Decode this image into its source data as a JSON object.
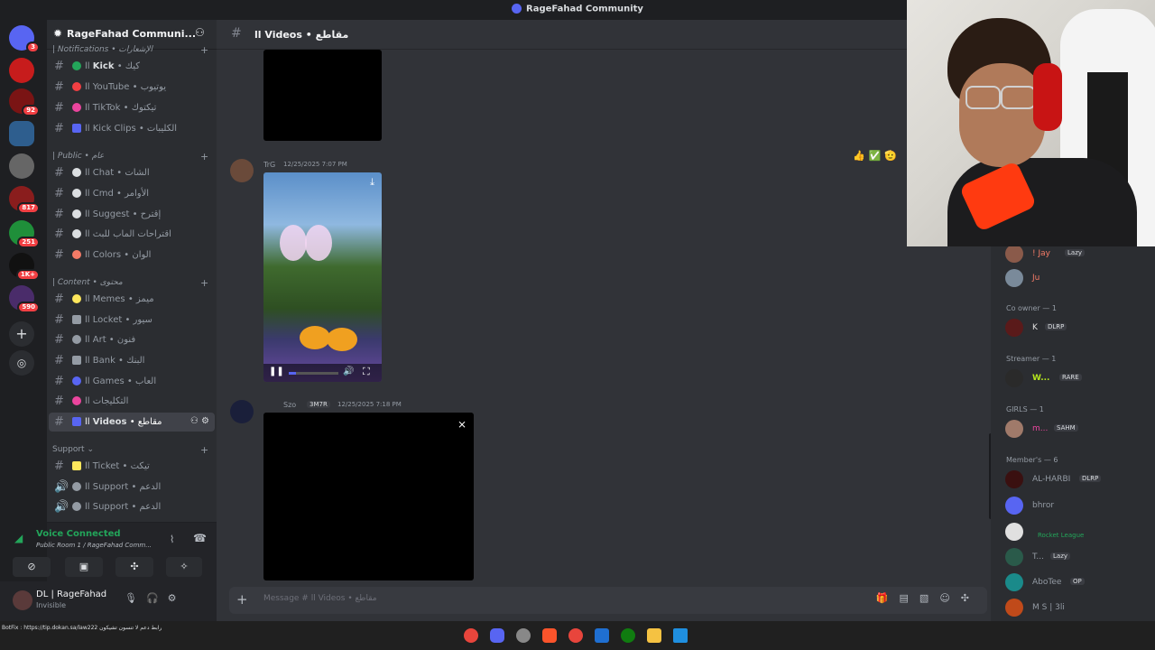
{
  "window": {
    "title": "RageFahad Community"
  },
  "server": {
    "name": "RageFahad Communi..."
  },
  "guild_badges": [
    "3",
    "92",
    "817",
    "251",
    "1K+",
    "590"
  ],
  "categories": {
    "notifications": "| Notifications • الإشعارات",
    "public": "| Public • عام",
    "content": "| Content • محتوى",
    "support": "Support"
  },
  "channels": [
    {
      "name": "Kick",
      "suffix": "كيك",
      "color": "#23a55a"
    },
    {
      "name": "YouTube",
      "suffix": "يوتيوب",
      "color": "#f23f43"
    },
    {
      "name": "TikTok",
      "suffix": "تيكتوك",
      "color": "#eb459e"
    },
    {
      "name": "Kick Clips",
      "suffix": "الكليبات",
      "color": "#5865f2"
    },
    {
      "name": "Chat",
      "suffix": "الشات",
      "color": "#dbdee1"
    },
    {
      "name": "Cmd",
      "suffix": "الأوامر",
      "color": "#dbdee1"
    },
    {
      "name": "Suggest",
      "suffix": "إقترح",
      "color": "#dbdee1"
    },
    {
      "name": "",
      "suffix": "اقتراحات الماب للبث",
      "color": "#dbdee1"
    },
    {
      "name": "Colors",
      "suffix": "الوان",
      "color": "#f47b67"
    },
    {
      "name": "Memes",
      "suffix": "ميمز",
      "color": "#fee75c"
    },
    {
      "name": "Locket",
      "suffix": "سيور",
      "color": "#949ba4"
    },
    {
      "name": "Art",
      "suffix": "فنون",
      "color": "#949ba4"
    },
    {
      "name": "Bank",
      "suffix": "البنك",
      "color": "#949ba4"
    },
    {
      "name": "Games",
      "suffix": "العاب",
      "color": "#5865f2"
    },
    {
      "name": "",
      "suffix": "التكليجات",
      "color": "#eb459e"
    },
    {
      "name": "Videos",
      "suffix": "مقاطع",
      "color": "#5865f2"
    },
    {
      "name": "Ticket",
      "suffix": "تيكت",
      "color": "#fee75c"
    },
    {
      "name": "Support",
      "suffix": "الدعم",
      "color": "#949ba4"
    },
    {
      "name": "Support",
      "suffix": "الدعم",
      "color": "#949ba4"
    }
  ],
  "voice": {
    "status": "Voice Connected",
    "room": "Public Room 1 / RageFahad Comm..."
  },
  "user": {
    "name": "DL | RageFahad",
    "status": "Invisible"
  },
  "chat": {
    "channel": "ll Videos • مقاطع",
    "messages": [
      {
        "author": "TrG",
        "time": "12/25/2025 7:07 PM"
      },
      {
        "author": "Szo",
        "tag": "3M7R",
        "time": "12/25/2025 7:18 PM"
      }
    ],
    "composer_placeholder": "Message # ll Videos • مقاطع"
  },
  "members": {
    "top": [
      {
        "name": "! Jay",
        "tag": "Lazy",
        "color": "#f47b67"
      },
      {
        "name": "Ju",
        "color": "#f47b67"
      }
    ],
    "groups": [
      {
        "title": "Co owner — 1",
        "members": [
          {
            "name": "K",
            "tag": "DLRP",
            "color": "#e0e0e0"
          }
        ]
      },
      {
        "title": "Streamer — 1",
        "members": [
          {
            "name": "W...",
            "tag": "RARE",
            "color": "#b5e61d"
          }
        ]
      },
      {
        "title": "GIRLS — 1",
        "members": [
          {
            "name": "m...",
            "tag": "SAHM",
            "color": "#eb459e"
          }
        ]
      },
      {
        "title": "Member's — 6",
        "members": [
          {
            "name": "AL-HARBI",
            "tag": "DLRP",
            "color": "#949ba4"
          },
          {
            "name": "bhror",
            "color": "#949ba4"
          },
          {
            "name": "Rocket League",
            "color": "#949ba4"
          },
          {
            "name": "T...",
            "tag": "Lazy",
            "color": "#949ba4"
          },
          {
            "name": "AboTee",
            "tag": "OP",
            "color": "#949ba4"
          },
          {
            "name": "M S | 3li",
            "color": "#949ba4"
          }
        ]
      }
    ]
  },
  "taskbar": {
    "ticker": "BotFix : https://tip.dokan.sa/law222  رابط دعم لا تنسون تشيكون"
  }
}
